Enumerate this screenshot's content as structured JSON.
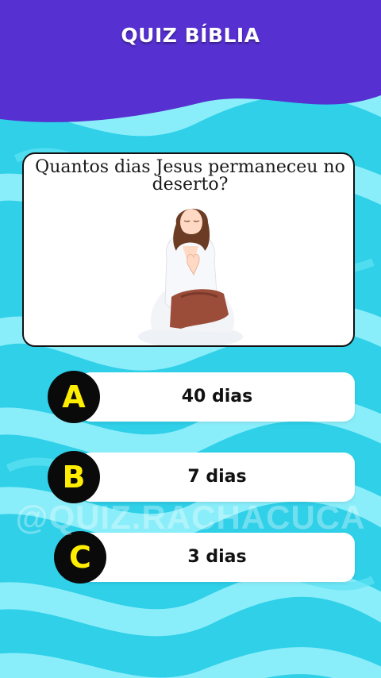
{
  "header": {
    "title": "QUIZ BÍBLIA"
  },
  "question": {
    "text": "Quantos dias Jesus permaneceu no deserto?",
    "image": "praying-jesus-illustration"
  },
  "answers": [
    {
      "letter": "A",
      "text": "40 dias"
    },
    {
      "letter": "B",
      "text": "7 dias"
    },
    {
      "letter": "C",
      "text": "3 dias"
    }
  ],
  "watermark": "@QUIZ.RACHACUCA",
  "colors": {
    "header": "#5630d0",
    "background": "#2fd0e8",
    "wave": "#8ff0fb",
    "letter_circle": "#0a0a0a",
    "letter_text": "#ffee00"
  }
}
